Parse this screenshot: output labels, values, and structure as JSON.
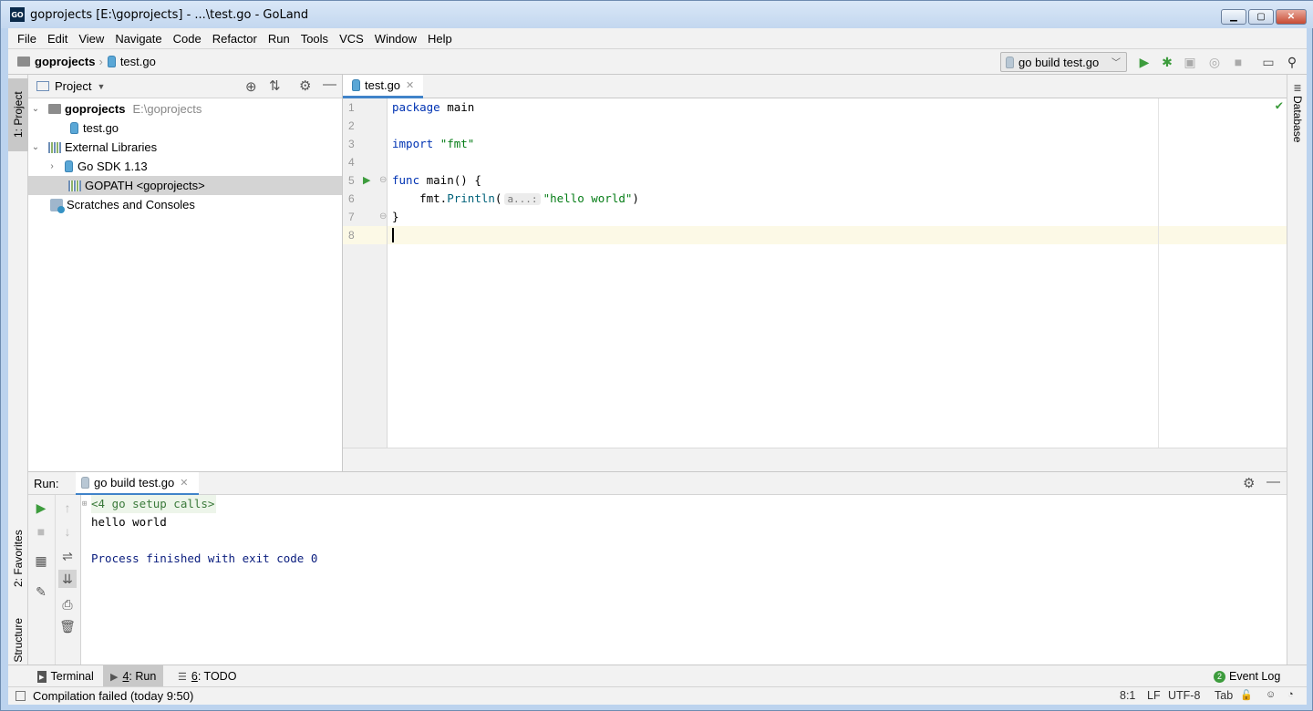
{
  "window": {
    "title": "goprojects [E:\\goprojects] - ...\\test.go - GoLand",
    "app_icon": "GO"
  },
  "menu": [
    "File",
    "Edit",
    "View",
    "Navigate",
    "Code",
    "Refactor",
    "Run",
    "Tools",
    "VCS",
    "Window",
    "Help"
  ],
  "breadcrumb": {
    "project": "goprojects",
    "file": "test.go"
  },
  "run_config": {
    "label": "go build test.go"
  },
  "left_stripe": {
    "project": "1: Project",
    "favorites": "2: Favorites",
    "structure": "7: Structure"
  },
  "right_stripe": {
    "database": "Database"
  },
  "project_panel": {
    "title": "Project",
    "tree": [
      {
        "label": "goprojects",
        "extra": "E:\\goprojects"
      },
      {
        "label": "test.go"
      },
      {
        "label": "External Libraries"
      },
      {
        "label": "Go SDK 1.13"
      },
      {
        "label": "GOPATH <goprojects>"
      },
      {
        "label": "Scratches and Consoles"
      }
    ]
  },
  "editor": {
    "tab": "test.go",
    "line_numbers": [
      "1",
      "2",
      "3",
      "4",
      "5",
      "6",
      "7",
      "8"
    ],
    "code": {
      "l1_kw": "package",
      "l1_rest": " main",
      "l3_kw": "import",
      "l3_str": "\"fmt\"",
      "l5_kw": "func",
      "l5_rest": " main() {",
      "l6_pre": "    fmt.",
      "l6_fn": "Println",
      "l6_open": "(",
      "l6_hint": "a...:",
      "l6_str": "\"hello world\"",
      "l6_close": ")",
      "l7": "}"
    }
  },
  "run_panel": {
    "label": "Run:",
    "tab": "go build test.go",
    "console": {
      "setup": "<4 go setup calls>",
      "output": "hello world",
      "finished": "Process finished with exit code 0"
    }
  },
  "bottom_bar": {
    "terminal": "Terminal",
    "run_num": "4",
    "run_label": ": Run",
    "todo_num": "6",
    "todo_label": ": TODO",
    "event_log_count": "2",
    "event_log": "Event Log"
  },
  "status_bar": {
    "message": "Compilation failed (today 9:50)",
    "position": "8:1",
    "line_sep": "LF",
    "encoding": "UTF-8",
    "indent": "Tab"
  },
  "colors": {
    "accent": "#4083c9",
    "run_green": "#3d9c3d",
    "keyword": "#0033b3",
    "string": "#067d17"
  }
}
